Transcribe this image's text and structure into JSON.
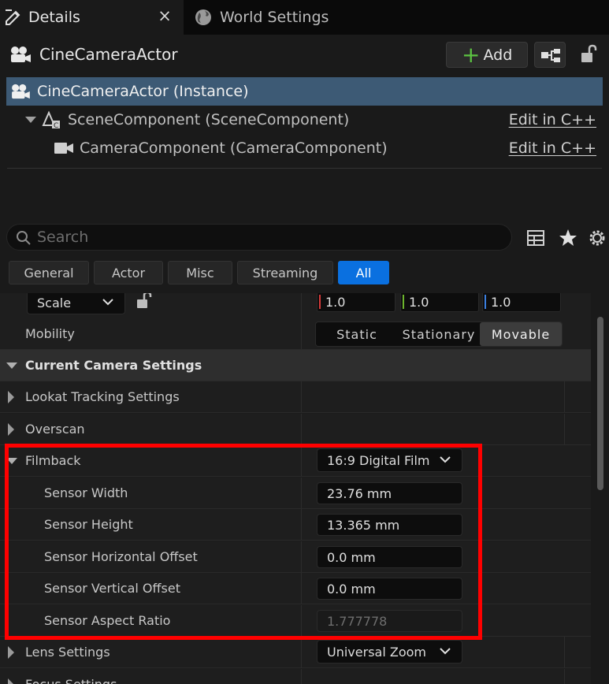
{
  "tabs": {
    "details_label": "Details",
    "close_glyph": "×",
    "world_settings_label": "World Settings"
  },
  "header": {
    "actor_name": "CineCameraActor",
    "add_label": "Add"
  },
  "tree": {
    "instance_label": "CineCameraActor (Instance)",
    "scene_component_label": "SceneComponent (SceneComponent)",
    "camera_component_label": "CameraComponent (CameraComponent)",
    "edit_label": "Edit in C++"
  },
  "search": {
    "placeholder": "Search"
  },
  "filter_tabs": [
    "General",
    "Actor",
    "Misc",
    "Streaming",
    "All"
  ],
  "active_filter": "All",
  "properties": {
    "scale_label": "Scale",
    "scale_values": [
      "1.0",
      "1.0",
      "1.0"
    ],
    "mobility_label": "Mobility",
    "mobility_options": [
      "Static",
      "Stationary",
      "Movable"
    ],
    "mobility_selected": "Movable",
    "current_camera_settings": "Current Camera Settings",
    "lookat_tracking": "Lookat Tracking Settings",
    "overscan": "Overscan",
    "filmback": "Filmback",
    "filmback_preset": "16:9 Digital Film",
    "sensor_width_label": "Sensor Width",
    "sensor_width_value": "23.76 mm",
    "sensor_height_label": "Sensor Height",
    "sensor_height_value": "13.365 mm",
    "sensor_h_offset_label": "Sensor Horizontal Offset",
    "sensor_h_offset_value": "0.0 mm",
    "sensor_v_offset_label": "Sensor Vertical Offset",
    "sensor_v_offset_value": "0.0 mm",
    "sensor_aspect_label": "Sensor Aspect Ratio",
    "sensor_aspect_value": "1.777778",
    "lens_settings": "Lens Settings",
    "lens_preset": "Universal Zoom",
    "focus_settings": "Focus Settings"
  },
  "colors": {
    "accent": "#0a70e0",
    "selected_row": "#3d5a75",
    "highlight": "#ff0000",
    "add_plus": "#5cc342",
    "scale_x": "#d63a3a",
    "scale_y": "#6cb52d",
    "scale_z": "#3a7fe0"
  }
}
